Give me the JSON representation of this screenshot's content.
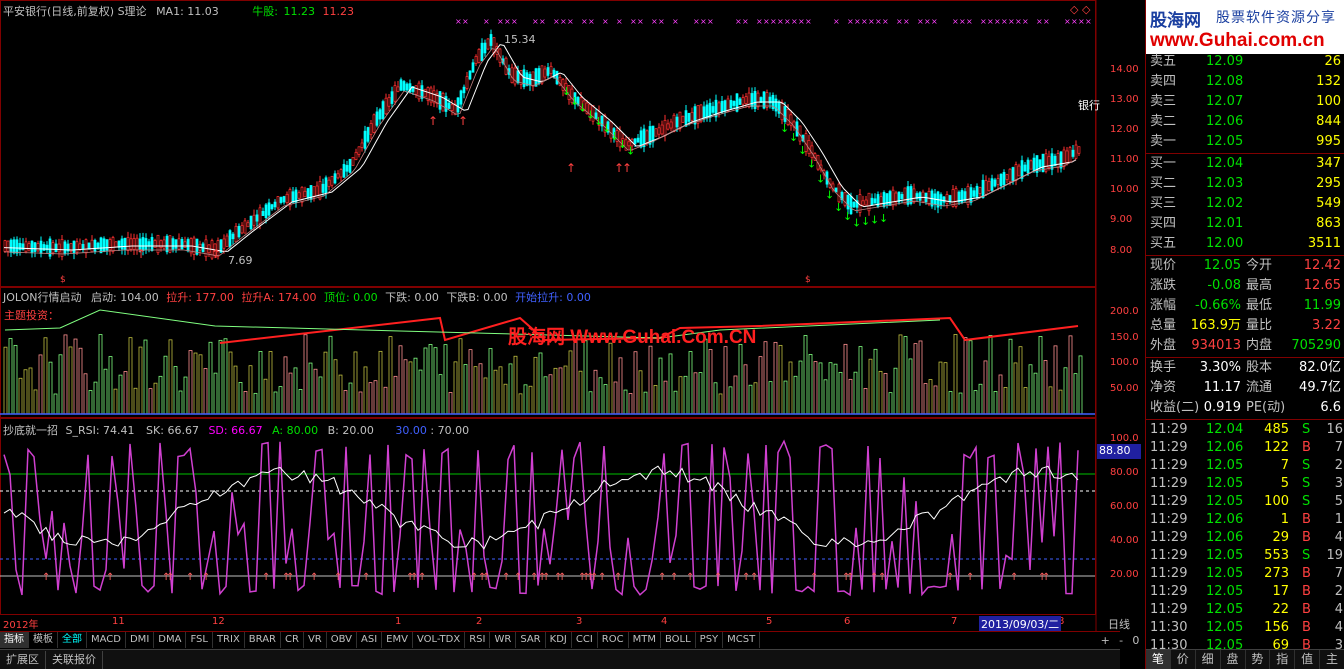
{
  "header": {
    "title": "平安银行(日线,前复权) S理论",
    "ma1": "MA1: 11.03",
    "bull_label": "牛股:",
    "bull_v1": "11.23",
    "bull_v2": "11.23",
    "high_label": "15.34",
    "low_label": "7.69",
    "right_label": "银行"
  },
  "price_axis": [
    "14.00",
    "13.00",
    "12.00",
    "11.00",
    "10.00",
    "9.00",
    "8.00"
  ],
  "ind1": {
    "name": "JOLON行情启动",
    "qidong": "启动: 104.00",
    "lasheng": "拉升: 177.00",
    "lashenga": "拉升A: 174.00",
    "dingwei": "顶位: 0.00",
    "xiadie": "下跌: 0.00",
    "xiadieb": "下跌B: 0.00",
    "kaishi": "开始拉升: 0.00",
    "theme": "主题投资：",
    "axis": [
      "200.0",
      "150.0",
      "100.0",
      "50.00"
    ],
    "watermark": "股海网 Www.Guhai.Com.CN"
  },
  "ind2": {
    "name": "抄底就一招",
    "srsi": "S_RSI: 74.41",
    "sk": "SK: 66.67",
    "sd": "SD: 66.67",
    "a": "A: 80.00",
    "b": "B: 20.00",
    "v30": "30.00",
    "v70": ": 70.00",
    "axis": [
      "100.0",
      "80.00",
      "60.00",
      "40.00",
      "20.00"
    ],
    "cur": "88.80"
  },
  "xaxis": {
    "labels": [
      "2012年",
      "11",
      "12",
      "1",
      "2",
      "3",
      "4",
      "5",
      "6",
      "7",
      "8",
      "9"
    ],
    "highlight": "2013/09/03/二",
    "period": "日线"
  },
  "tabs": [
    "指标",
    "模板",
    "全部",
    "MACD",
    "DMI",
    "DMA",
    "FSL",
    "TRIX",
    "BRAR",
    "CR",
    "VR",
    "OBV",
    "ASI",
    "EMV",
    "VOL-TDX",
    "RSI",
    "WR",
    "SAR",
    "KDJ",
    "CCI",
    "ROC",
    "MTM",
    "BOLL",
    "PSY",
    "MCST"
  ],
  "tab_controls": [
    "+",
    "-",
    "0"
  ],
  "bottom_buttons": [
    "扩展区",
    "关联报价"
  ],
  "logo": {
    "name": "股海网",
    "slogan": "股票软件资源分享",
    "url": "www.Guhai.com.cn"
  },
  "asks": [
    {
      "label": "卖五",
      "price": "12.09",
      "vol": "26"
    },
    {
      "label": "卖四",
      "price": "12.08",
      "vol": "132"
    },
    {
      "label": "卖三",
      "price": "12.07",
      "vol": "100"
    },
    {
      "label": "卖二",
      "price": "12.06",
      "vol": "844"
    },
    {
      "label": "卖一",
      "price": "12.05",
      "vol": "995"
    }
  ],
  "bids": [
    {
      "label": "买一",
      "price": "12.04",
      "vol": "347"
    },
    {
      "label": "买二",
      "price": "12.03",
      "vol": "295"
    },
    {
      "label": "买三",
      "price": "12.02",
      "vol": "549"
    },
    {
      "label": "买四",
      "price": "12.01",
      "vol": "863"
    },
    {
      "label": "买五",
      "price": "12.00",
      "vol": "3511"
    }
  ],
  "stats": [
    {
      "l1": "现价",
      "v1": "12.05",
      "c1": "c-g",
      "l2": "今开",
      "v2": "12.42",
      "c2": "c-r"
    },
    {
      "l1": "涨跌",
      "v1": "-0.08",
      "c1": "c-g",
      "l2": "最高",
      "v2": "12.65",
      "c2": "c-r"
    },
    {
      "l1": "涨幅",
      "v1": "-0.66%",
      "c1": "c-g",
      "l2": "最低",
      "v2": "11.99",
      "c2": "c-g"
    },
    {
      "l1": "总量",
      "v1": "163.9万",
      "c1": "c-y",
      "l2": "量比",
      "v2": "3.22",
      "c2": "c-r"
    },
    {
      "l1": "外盘",
      "v1": "934013",
      "c1": "c-r",
      "l2": "内盘",
      "v2": "705290",
      "c2": "c-g"
    },
    {
      "l1": "换手",
      "v1": "3.30%",
      "c1": "c-wh",
      "l2": "股本",
      "v2": "82.0亿",
      "c2": "c-wh"
    },
    {
      "l1": "净资",
      "v1": "11.17",
      "c1": "c-wh",
      "l2": "流通",
      "v2": "49.7亿",
      "c2": "c-wh"
    },
    {
      "l1": "收益(二)",
      "v1": "0.919",
      "c1": "c-wh",
      "l2": "PE(动)",
      "v2": "6.6",
      "c2": "c-wh"
    }
  ],
  "ticks": [
    {
      "t": "11:29",
      "p": "12.04",
      "v": "485",
      "s": "S",
      "n": "16"
    },
    {
      "t": "11:29",
      "p": "12.06",
      "v": "122",
      "s": "B",
      "n": "7"
    },
    {
      "t": "11:29",
      "p": "12.05",
      "v": "7",
      "s": "S",
      "n": "2"
    },
    {
      "t": "11:29",
      "p": "12.05",
      "v": "5",
      "s": "S",
      "n": "3"
    },
    {
      "t": "11:29",
      "p": "12.05",
      "v": "100",
      "s": "S",
      "n": "5"
    },
    {
      "t": "11:29",
      "p": "12.06",
      "v": "1",
      "s": "B",
      "n": "1"
    },
    {
      "t": "11:29",
      "p": "12.06",
      "v": "29",
      "s": "B",
      "n": "4"
    },
    {
      "t": "11:29",
      "p": "12.05",
      "v": "553",
      "s": "S",
      "n": "19"
    },
    {
      "t": "11:29",
      "p": "12.05",
      "v": "273",
      "s": "B",
      "n": "7"
    },
    {
      "t": "11:29",
      "p": "12.05",
      "v": "17",
      "s": "B",
      "n": "2"
    },
    {
      "t": "11:29",
      "p": "12.05",
      "v": "22",
      "s": "B",
      "n": "4"
    },
    {
      "t": "11:30",
      "p": "12.05",
      "v": "156",
      "s": "B",
      "n": "4"
    },
    {
      "t": "11:30",
      "p": "12.05",
      "v": "69",
      "s": "B",
      "n": "3"
    }
  ],
  "right_tabs": [
    "笔",
    "价",
    "细",
    "盘",
    "势",
    "指",
    "值",
    "主"
  ],
  "colors": {
    "up": "#ff3030",
    "down": "#00ffff",
    "ma": "#ffffff",
    "bull": "#00ff00",
    "frame": "#800000"
  }
}
